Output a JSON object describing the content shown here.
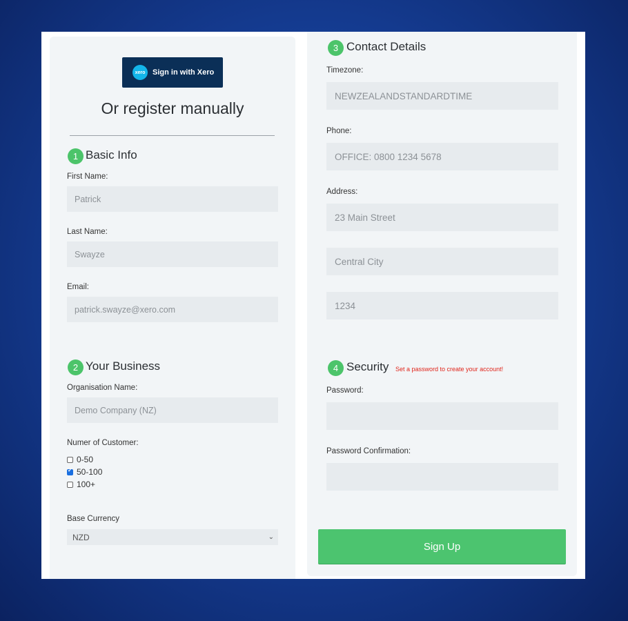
{
  "xero_signin": {
    "label": "Sign in with Xero",
    "logo_text": "xero"
  },
  "register_title": "Or register manually",
  "sections": {
    "basic": {
      "num": "1",
      "title": "Basic Info"
    },
    "business": {
      "num": "2",
      "title": "Your Business"
    },
    "contact": {
      "num": "3",
      "title": "Contact Details"
    },
    "security": {
      "num": "4",
      "title": "Security",
      "note": "Set a password to create your account!"
    }
  },
  "basic": {
    "first_name_label": "First Name:",
    "first_name_value": "Patrick",
    "last_name_label": "Last Name:",
    "last_name_value": "Swayze",
    "email_label": "Email:",
    "email_value": "patrick.swayze@xero.com"
  },
  "business": {
    "org_label": "Organisation Name:",
    "org_value": "Demo Company (NZ)",
    "customers_label": "Numer of Customer:",
    "customer_options": [
      {
        "label": "0-50",
        "checked": false
      },
      {
        "label": "50-100",
        "checked": true
      },
      {
        "label": "100+",
        "checked": false
      }
    ],
    "currency_label": "Base Currency",
    "currency_value": "NZD"
  },
  "contact": {
    "timezone_label": "Timezone:",
    "timezone_value": "NEWZEALANDSTANDARDTIME",
    "phone_label": "Phone:",
    "phone_value": "OFFICE: 0800 1234 5678",
    "address_label": "Address:",
    "address_line1": "23 Main Street",
    "address_line2": "Central City",
    "address_line3": "1234"
  },
  "security": {
    "password_label": "Password:",
    "password_value": "",
    "confirm_label": "Password Confirmation:",
    "confirm_value": ""
  },
  "signup_label": "Sign Up",
  "colors": {
    "accent_green": "#4cc46a",
    "xero_navy": "#0b2f57",
    "xero_blue": "#13b5ea",
    "error_red": "#e0251b"
  }
}
